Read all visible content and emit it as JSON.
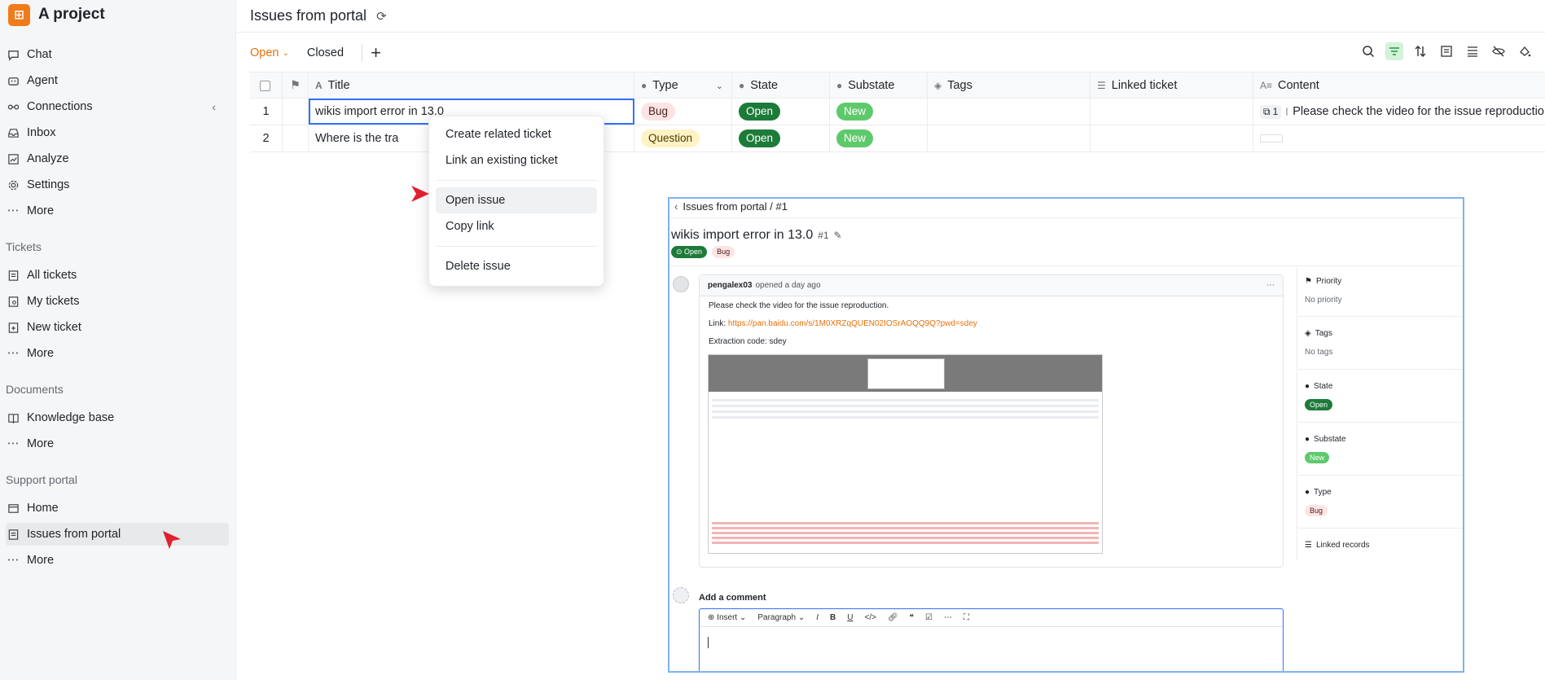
{
  "project": {
    "logo_glyph": "⊞",
    "name": "A project"
  },
  "sidebar": {
    "main_items": [
      {
        "label": "Chat",
        "icon": "chat-icon"
      },
      {
        "label": "Agent",
        "icon": "agent-icon"
      },
      {
        "label": "Connections",
        "icon": "connections-icon"
      },
      {
        "label": "Inbox",
        "icon": "inbox-icon"
      },
      {
        "label": "Analyze",
        "icon": "analyze-icon"
      },
      {
        "label": "Settings",
        "icon": "settings-icon"
      },
      {
        "label": "More",
        "icon": "ellipsis-icon"
      }
    ],
    "tickets_section": "Tickets",
    "tickets_items": [
      {
        "label": "All tickets"
      },
      {
        "label": "My tickets"
      },
      {
        "label": "New ticket"
      },
      {
        "label": "More"
      }
    ],
    "documents_section": "Documents",
    "documents_items": [
      {
        "label": "Knowledge base"
      },
      {
        "label": "More"
      }
    ],
    "portal_section": "Support portal",
    "portal_items": [
      {
        "label": "Home"
      },
      {
        "label": "Issues from portal"
      },
      {
        "label": "More"
      }
    ]
  },
  "header": {
    "title": "Issues from portal"
  },
  "views": {
    "open": "Open",
    "closed": "Closed"
  },
  "table": {
    "columns": [
      "Title",
      "Type",
      "State",
      "Substate",
      "Tags",
      "Linked ticket",
      "Content"
    ],
    "rows": [
      {
        "num": "1",
        "title": "wikis import error in 13.0",
        "type": "Bug",
        "state": "Open",
        "substate": "New",
        "content_count": "1",
        "content": "Please check the video for the issue reproduction."
      },
      {
        "num": "2",
        "title": "Where is the tra",
        "type": "Question",
        "state": "Open",
        "substate": "New",
        "content_count": "",
        "content": ""
      }
    ]
  },
  "context_menu": {
    "items_group1": [
      "Create related ticket",
      "Link an existing ticket"
    ],
    "items_group2": [
      "Open issue",
      "Copy link"
    ],
    "items_group3": [
      "Delete issue"
    ]
  },
  "detail": {
    "breadcrumb": "Issues from portal / #1",
    "title": "wikis import error in 13.0",
    "number": "#1",
    "state": "Open",
    "type": "Bug",
    "author": "pengalex03",
    "opened": "opened a day ago",
    "body_line1": "Please check the video for the issue reproduction.",
    "link_label": "Link:",
    "link": "https://pan.baidu.com/s/1M0XRZqQUEN02IOSrAOQQ9Q?pwd=sdey",
    "extraction": "Extraction code: sdey",
    "props": {
      "priority_label": "Priority",
      "priority_val": "No priority",
      "tags_label": "Tags",
      "tags_val": "No tags",
      "state_label": "State",
      "state_val": "Open",
      "substate_label": "Substate",
      "substate_val": "New",
      "type_label": "Type",
      "type_val": "Bug",
      "linked_label": "Linked records"
    },
    "add_comment": "Add a comment",
    "editor": {
      "insert": "Insert",
      "paragraph": "Paragraph"
    }
  },
  "colors": {
    "accent": "#e8710a",
    "open_green": "#1d7b3a",
    "new_green": "#5ec96b",
    "cursor_red": "#e0202e"
  }
}
